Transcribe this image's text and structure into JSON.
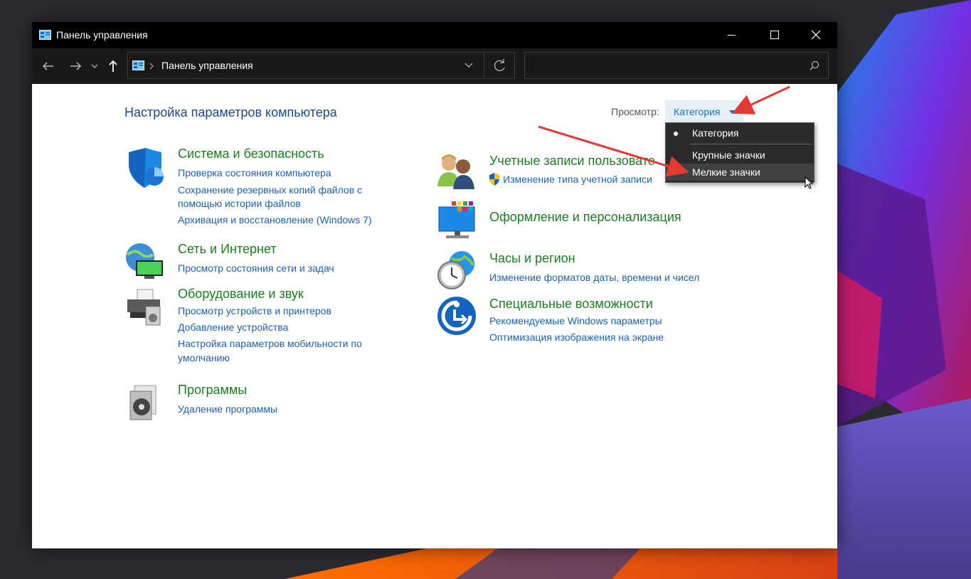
{
  "window": {
    "title": "Панель управления"
  },
  "navbar": {
    "address_text": "Панель управления",
    "search_placeholder": ""
  },
  "header": {
    "page_title": "Настройка параметров компьютера",
    "view_label": "Просмотр:",
    "view_value": "Категория"
  },
  "view_menu": {
    "items": [
      {
        "label": "Категория",
        "selected": true
      },
      {
        "label": "Крупные значки",
        "selected": false
      },
      {
        "label": "Мелкие значки",
        "selected": false
      }
    ]
  },
  "categories_left": [
    {
      "title": "Система и безопасность",
      "links": [
        "Проверка состояния компьютера",
        "Сохранение резервных копий файлов с",
        "помощью истории файлов",
        "Архивация и восстановление (Windows 7)"
      ]
    },
    {
      "title": "Сеть и Интернет",
      "links": [
        "Просмотр состояния сети и задач"
      ]
    },
    {
      "title": "Оборудование и звук",
      "links": [
        "Просмотр устройств и принтеров",
        "Добавление устройства",
        "Настройка параметров мобильности по",
        "умолчанию"
      ]
    },
    {
      "title": "Программы",
      "links": [
        "Удаление программы"
      ]
    }
  ],
  "categories_right": [
    {
      "title": "Учетные записи пользовате",
      "links": [
        "Изменение типа учетной записи"
      ]
    },
    {
      "title": "Оформление и персонализация",
      "links": []
    },
    {
      "title": "Часы и регион",
      "links": [
        "Изменение форматов даты, времени и чисел"
      ]
    },
    {
      "title": "Специальные возможности",
      "links": [
        "Рекомендуемые Windows параметры",
        "Оптимизация изображения на экране"
      ]
    }
  ],
  "colors": {
    "category_title": "#1b7e1f",
    "link": "#1a62b8",
    "page_title": "#1c4a8c",
    "titlebar": "#000000",
    "annotation_arrow": "#e53935"
  }
}
